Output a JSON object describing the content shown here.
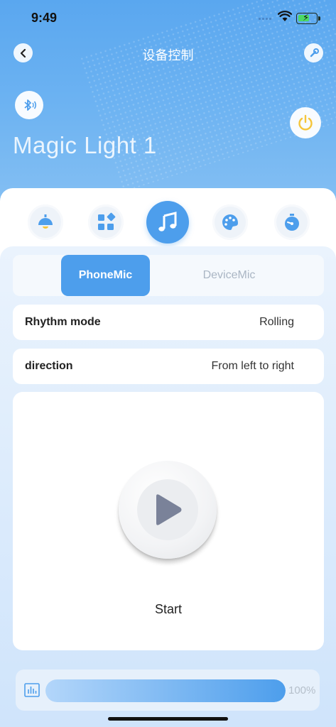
{
  "status_bar": {
    "time": "9:49"
  },
  "nav": {
    "title": "设备控制"
  },
  "device": {
    "name": "Magic Light 1"
  },
  "mode_tabs": [
    {
      "icon": "lamp-icon",
      "active": false
    },
    {
      "icon": "scene-grid-icon",
      "active": false
    },
    {
      "icon": "music-note-icon",
      "active": true
    },
    {
      "icon": "palette-icon",
      "active": false
    },
    {
      "icon": "timer-icon",
      "active": false
    }
  ],
  "mic_source": {
    "options": [
      "PhoneMic",
      "DeviceMic"
    ],
    "selected": "PhoneMic"
  },
  "settings": [
    {
      "label": "Rhythm mode",
      "value": "Rolling"
    },
    {
      "label": "direction",
      "value": "From left to right"
    }
  ],
  "player": {
    "start_label": "Start"
  },
  "brightness": {
    "value": 100,
    "display": "100%"
  },
  "colors": {
    "accent": "#4d9eec",
    "power": "#f5c53b"
  }
}
